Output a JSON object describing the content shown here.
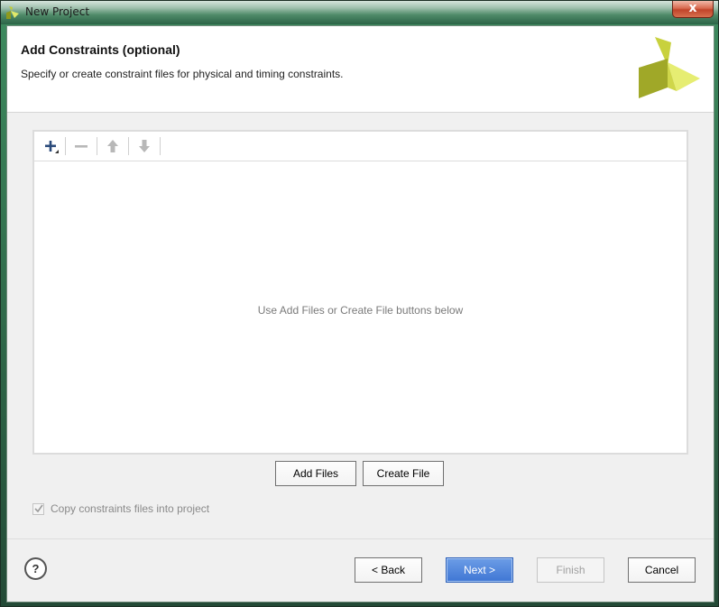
{
  "window": {
    "title": "New Project",
    "close_glyph": "x"
  },
  "header": {
    "title": "Add Constraints (optional)",
    "subtitle": "Specify or create constraint files for physical and timing constraints."
  },
  "file_table": {
    "toolbar": {
      "add_icon": "plus-icon",
      "remove_icon": "minus-icon",
      "move_up_icon": "arrow-up-icon",
      "move_down_icon": "arrow-down-icon"
    },
    "empty_message": "Use Add Files or Create File buttons below"
  },
  "actions": {
    "add_files": "Add Files",
    "create_file": "Create File"
  },
  "options": {
    "copy_constraints_label": "Copy constraints files into project",
    "copy_constraints_checked": true
  },
  "footer": {
    "help_glyph": "?",
    "back": "< Back",
    "next": "Next >",
    "finish": "Finish",
    "cancel": "Cancel"
  },
  "colors": {
    "accent": "#3f76d4",
    "logo_dark": "#a7b02a",
    "logo_light": "#e8ef6b"
  }
}
